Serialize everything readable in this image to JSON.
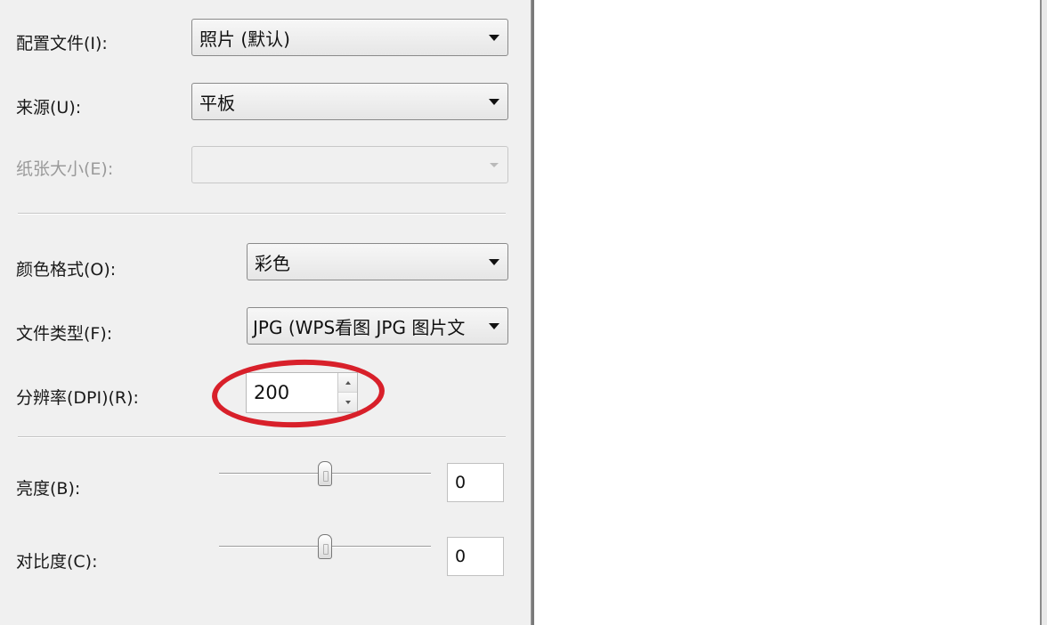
{
  "form": {
    "profile": {
      "label": "配置文件(I):",
      "value": "照片 (默认)"
    },
    "source": {
      "label": "来源(U):",
      "value": "平板"
    },
    "paper_size": {
      "label": "纸张大小(E):",
      "value": ""
    },
    "color_format": {
      "label": "颜色格式(O):",
      "value": "彩色"
    },
    "file_type": {
      "label": "文件类型(F):",
      "value": "JPG (WPS看图 JPG 图片文"
    },
    "resolution": {
      "label": "分辨率(DPI)(R):",
      "value": "200"
    },
    "brightness": {
      "label": "亮度(B):",
      "value": "0",
      "level": 0.5
    },
    "contrast": {
      "label": "对比度(C):",
      "value": "0",
      "level": 0.5
    }
  },
  "colors": {
    "annotation": "#d8202a",
    "panel_bg": "#f0f0f0",
    "preview_bg": "#ffffff"
  },
  "icons": {
    "dropdown": "chevron-down-icon",
    "spin_up": "spin-up-icon",
    "spin_down": "spin-down-icon"
  }
}
